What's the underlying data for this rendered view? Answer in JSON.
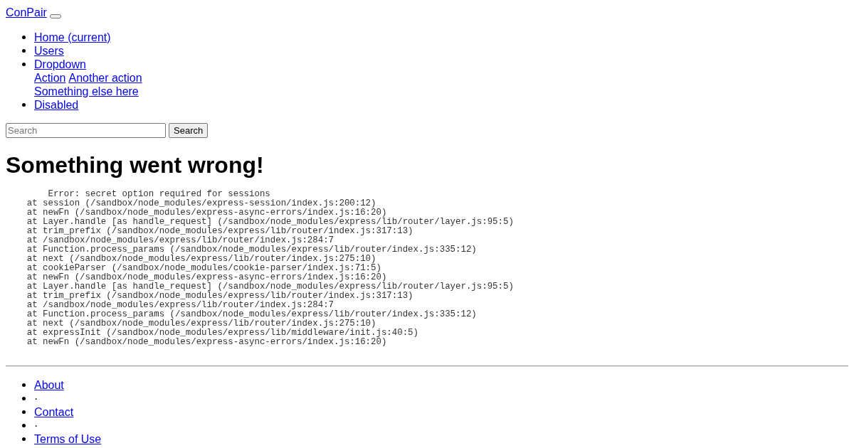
{
  "brand": "ConPair",
  "nav": {
    "items": [
      {
        "label": "Home (current)"
      },
      {
        "label": "Users"
      },
      {
        "label": "Dropdown",
        "menu_items": [
          "Action",
          "Another action",
          "Something else here"
        ]
      },
      {
        "label": "Disabled"
      }
    ]
  },
  "search": {
    "placeholder": "Search",
    "button": "Search"
  },
  "error": {
    "title": "Something went wrong!",
    "stack": "        Error: secret option required for sessions\n    at session (/sandbox/node_modules/express-session/index.js:200:12)\n    at newFn (/sandbox/node_modules/express-async-errors/index.js:16:20)\n    at Layer.handle [as handle_request] (/sandbox/node_modules/express/lib/router/layer.js:95:5)\n    at trim_prefix (/sandbox/node_modules/express/lib/router/index.js:317:13)\n    at /sandbox/node_modules/express/lib/router/index.js:284:7\n    at Function.process_params (/sandbox/node_modules/express/lib/router/index.js:335:12)\n    at next (/sandbox/node_modules/express/lib/router/index.js:275:10)\n    at cookieParser (/sandbox/node_modules/cookie-parser/index.js:71:5)\n    at newFn (/sandbox/node_modules/express-async-errors/index.js:16:20)\n    at Layer.handle [as handle_request] (/sandbox/node_modules/express/lib/router/layer.js:95:5)\n    at trim_prefix (/sandbox/node_modules/express/lib/router/index.js:317:13)\n    at /sandbox/node_modules/express/lib/router/index.js:284:7\n    at Function.process_params (/sandbox/node_modules/express/lib/router/index.js:335:12)\n    at next (/sandbox/node_modules/express/lib/router/index.js:275:10)\n    at expressInit (/sandbox/node_modules/express/lib/middleware/init.js:40:5)\n    at newFn (/sandbox/node_modules/express-async-errors/index.js:16:20)"
  },
  "footer": {
    "items": [
      {
        "kind": "link",
        "label": "About"
      },
      {
        "kind": "separator",
        "label": "·"
      },
      {
        "kind": "link",
        "label": "Contact"
      },
      {
        "kind": "separator",
        "label": "·"
      },
      {
        "kind": "link",
        "label": "Terms of Use"
      }
    ]
  }
}
